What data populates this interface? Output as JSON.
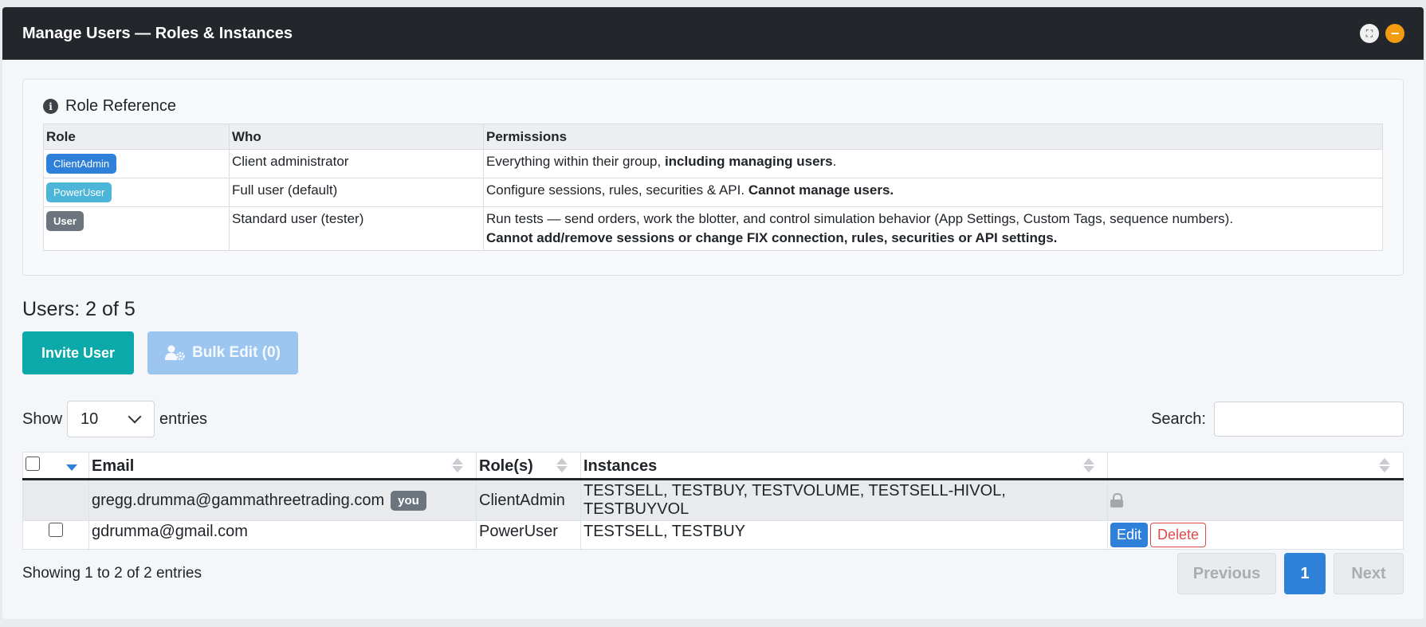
{
  "window": {
    "title": "Manage Users — Roles & Instances",
    "fullscreen_glyph": "⛶",
    "minimize_glyph": "−"
  },
  "role_reference": {
    "heading": "Role Reference",
    "info_glyph": "i",
    "headers": {
      "role": "Role",
      "who": "Who",
      "permissions": "Permissions"
    },
    "rows": [
      {
        "role": "ClientAdmin",
        "who": "Client administrator",
        "perm_plain": "Everything within their group, ",
        "perm_bold": "including managing users",
        "perm_tail": "."
      },
      {
        "role": "PowerUser",
        "who": "Full user (default)",
        "perm_plain": "Configure sessions, rules, securities & API. ",
        "perm_bold": "Cannot manage users.",
        "perm_tail": ""
      },
      {
        "role": "User",
        "who": "Standard user (tester)",
        "perm_plain": "Run tests — send orders, work the blotter, and control simulation behavior (App Settings, Custom Tags, sequence numbers).",
        "perm_bold": "Cannot add/remove sessions or change FIX connection, rules, securities or API settings.",
        "perm_tail": ""
      }
    ]
  },
  "users": {
    "heading": "Users: 2 of 5",
    "invite_label": "Invite User",
    "bulk_edit_label": "Bulk Edit (0)",
    "show_label": "Show",
    "page_size": "10",
    "entries_label": "entries",
    "search_label": "Search:",
    "search_value": "",
    "columns": {
      "email": "Email",
      "roles": "Role(s)",
      "instances": "Instances"
    },
    "rows": [
      {
        "email": "gregg.drumma@gammathreetrading.com",
        "you_badge": "you",
        "role": "ClientAdmin",
        "instances": "TESTSELL, TESTBUY, TESTVOLUME, TESTSELL-HIVOL, TESTBUYVOL"
      },
      {
        "email": "gdrumma@gmail.com",
        "role": "PowerUser",
        "instances": "TESTSELL, TESTBUY",
        "edit_label": "Edit",
        "delete_label": "Delete"
      }
    ],
    "info": "Showing 1 to 2 of 2 entries",
    "pager": {
      "previous": "Previous",
      "current": "1",
      "next": "Next"
    }
  }
}
